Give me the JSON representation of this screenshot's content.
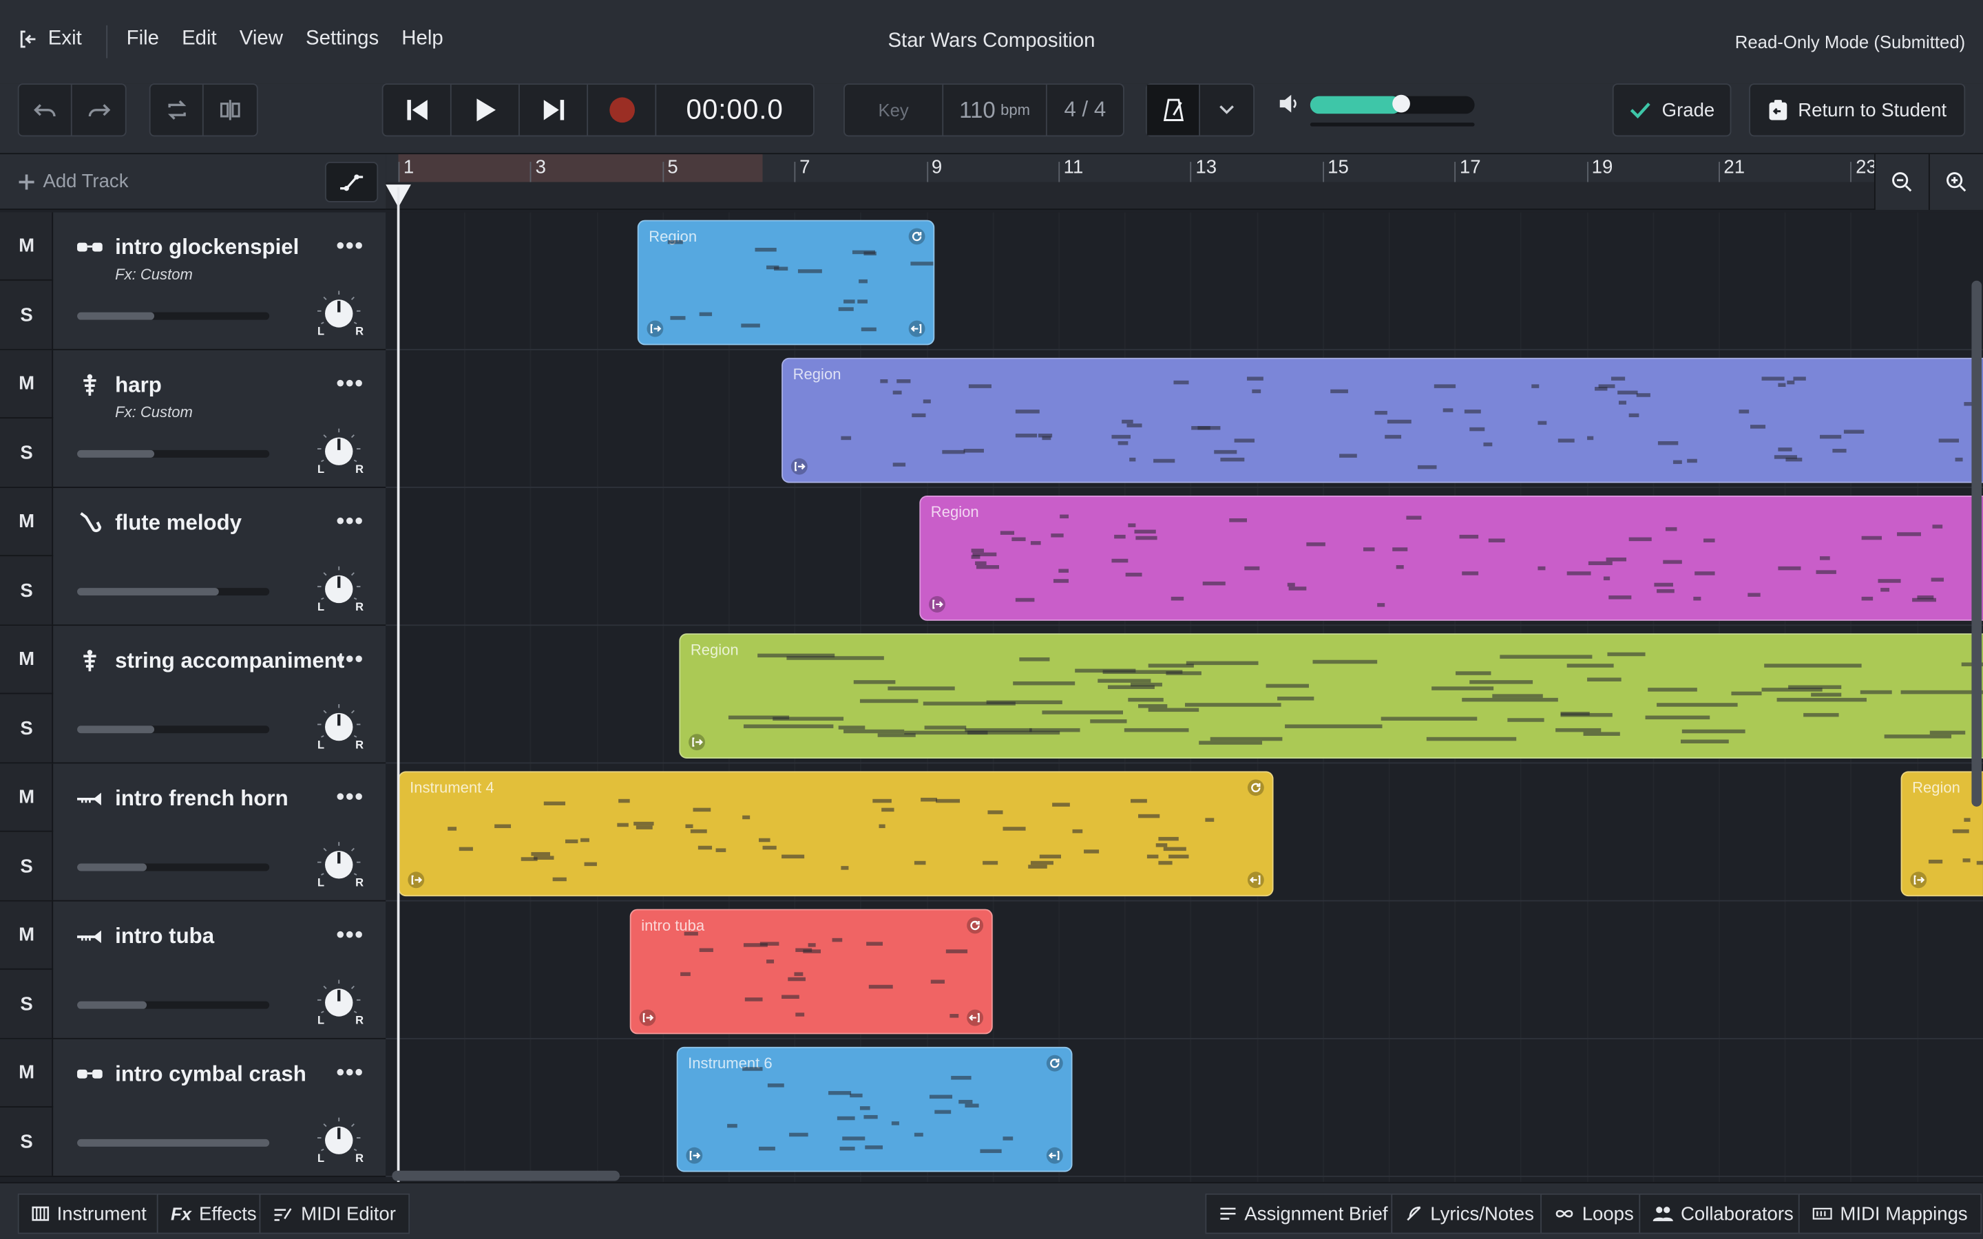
{
  "menubar": {
    "exit_label": "Exit",
    "menus": [
      "File",
      "Edit",
      "View",
      "Settings",
      "Help"
    ],
    "title": "Star Wars Composition",
    "mode": "Read-Only Mode (Submitted)"
  },
  "toolbar": {
    "time": "00:00.0",
    "key_label": "Key",
    "bpm_value": "110",
    "bpm_unit": "bpm",
    "time_signature": "4 / 4",
    "volume_level": 0.55,
    "grade_label": "Grade",
    "return_label": "Return to Student",
    "accent_color": "#3ec6a8"
  },
  "tracks_panel": {
    "add_track_label": "Add Track",
    "mute_label": "M",
    "solo_label": "S",
    "pan_left": "L",
    "pan_right": "R",
    "more_label": "•••",
    "tracks": [
      {
        "name": "intro glockenspiel",
        "fx": "Fx: Custom",
        "icon": "glasses-icon",
        "volume": 0.4
      },
      {
        "name": "harp",
        "fx": "Fx: Custom",
        "icon": "harp-icon",
        "volume": 0.4
      },
      {
        "name": "flute melody",
        "fx": "",
        "icon": "saxophone-icon",
        "volume": 0.74
      },
      {
        "name": "string accompaniment",
        "fx": "",
        "icon": "harp-icon",
        "volume": 0.4
      },
      {
        "name": "intro french horn",
        "fx": "",
        "icon": "trumpet-icon",
        "volume": 0.36
      },
      {
        "name": "intro tuba",
        "fx": "",
        "icon": "trumpet-icon",
        "volume": 0.36
      },
      {
        "name": "intro cymbal crash",
        "fx": "",
        "icon": "glasses-icon",
        "volume": 1.0
      }
    ]
  },
  "ruler": {
    "bar_numbers": [
      "1",
      "3",
      "5",
      "7",
      "9",
      "11",
      "13",
      "15",
      "17",
      "19",
      "21",
      "23"
    ]
  },
  "regions": [
    {
      "label": "Region",
      "color": "#56a8e0"
    },
    {
      "label": "Region",
      "color": "#7b86d8"
    },
    {
      "label": "Region",
      "color": "#c95ec9"
    },
    {
      "label": "Region",
      "color": "#abc955"
    },
    {
      "label": "Instrument 4",
      "color": "#e2bf3a"
    },
    {
      "label": "Region",
      "color": "#e2bf3a"
    },
    {
      "label": "intro tuba",
      "color": "#f06464"
    },
    {
      "label": "Instrument 6",
      "color": "#56a8e0"
    }
  ],
  "bottombar": {
    "instrument": "Instrument",
    "effects": "Effects",
    "midi_editor": "MIDI Editor",
    "assignment_brief": "Assignment Brief",
    "lyrics_notes": "Lyrics/Notes",
    "loops": "Loops",
    "collaborators": "Collaborators",
    "midi_mappings": "MIDI Mappings"
  }
}
